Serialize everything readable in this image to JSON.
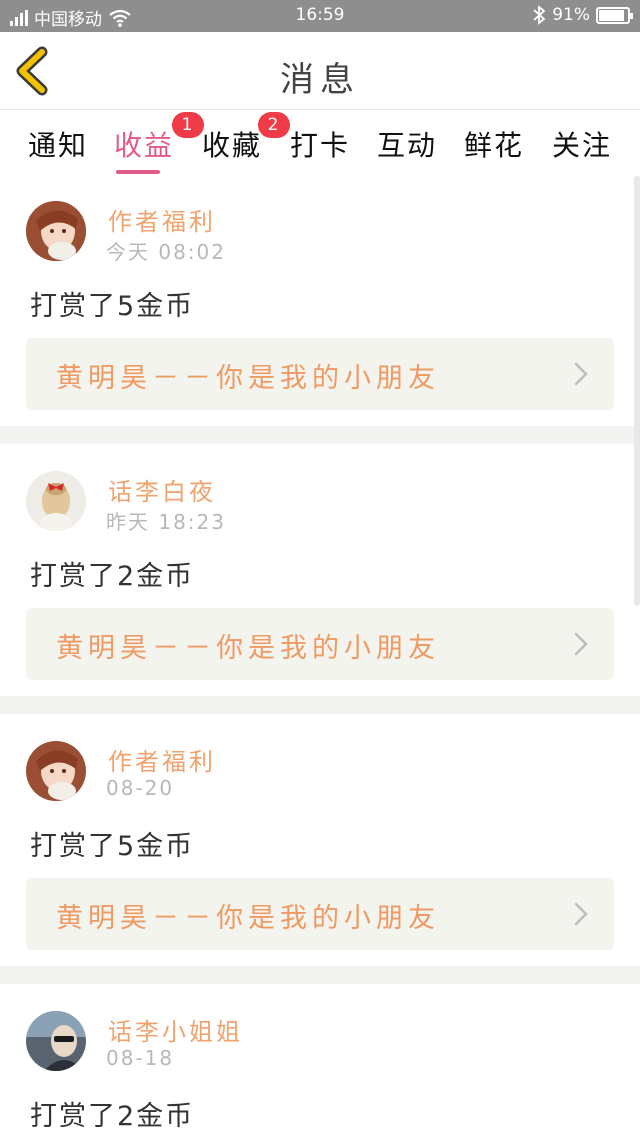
{
  "status_bar": {
    "carrier": "中国移动",
    "time": "16:59",
    "battery_text": "91%",
    "battery_level": 0.91
  },
  "nav": {
    "title": "消息"
  },
  "tabs": [
    {
      "label": "通知",
      "badge": ""
    },
    {
      "label": "收益",
      "badge": "1",
      "active": true
    },
    {
      "label": "收藏",
      "badge": "2"
    },
    {
      "label": "打卡",
      "badge": ""
    },
    {
      "label": "互动",
      "badge": ""
    },
    {
      "label": "鲜花",
      "badge": ""
    },
    {
      "label": "关注",
      "badge": ""
    }
  ],
  "messages": [
    {
      "username": "作者福利",
      "time": "今天 08:02",
      "text": "打赏了5金币",
      "link": "黄明昊－－你是我的小朋友",
      "avatar": "girl-brown-hair-avatar"
    },
    {
      "username": "话李白夜",
      "time": "昨天 18:23",
      "text": "打赏了2金币",
      "link": "黄明昊－－你是我的小朋友",
      "avatar": "girl-red-bow-avatar"
    },
    {
      "username": "作者福利",
      "time": "08-20",
      "text": "打赏了5金币",
      "link": "黄明昊－－你是我的小朋友",
      "avatar": "girl-brown-hair-avatar"
    },
    {
      "username": "话李小姐姐",
      "time": "08-18",
      "text": "打赏了2金币",
      "link": "",
      "avatar": "man-sunglasses-avatar"
    }
  ],
  "colors": {
    "accent": "#e25b8c",
    "badge": "#ee3b47",
    "username": "#f0a36e",
    "link": "#f09a63",
    "back_arrow": "#f2c200"
  }
}
